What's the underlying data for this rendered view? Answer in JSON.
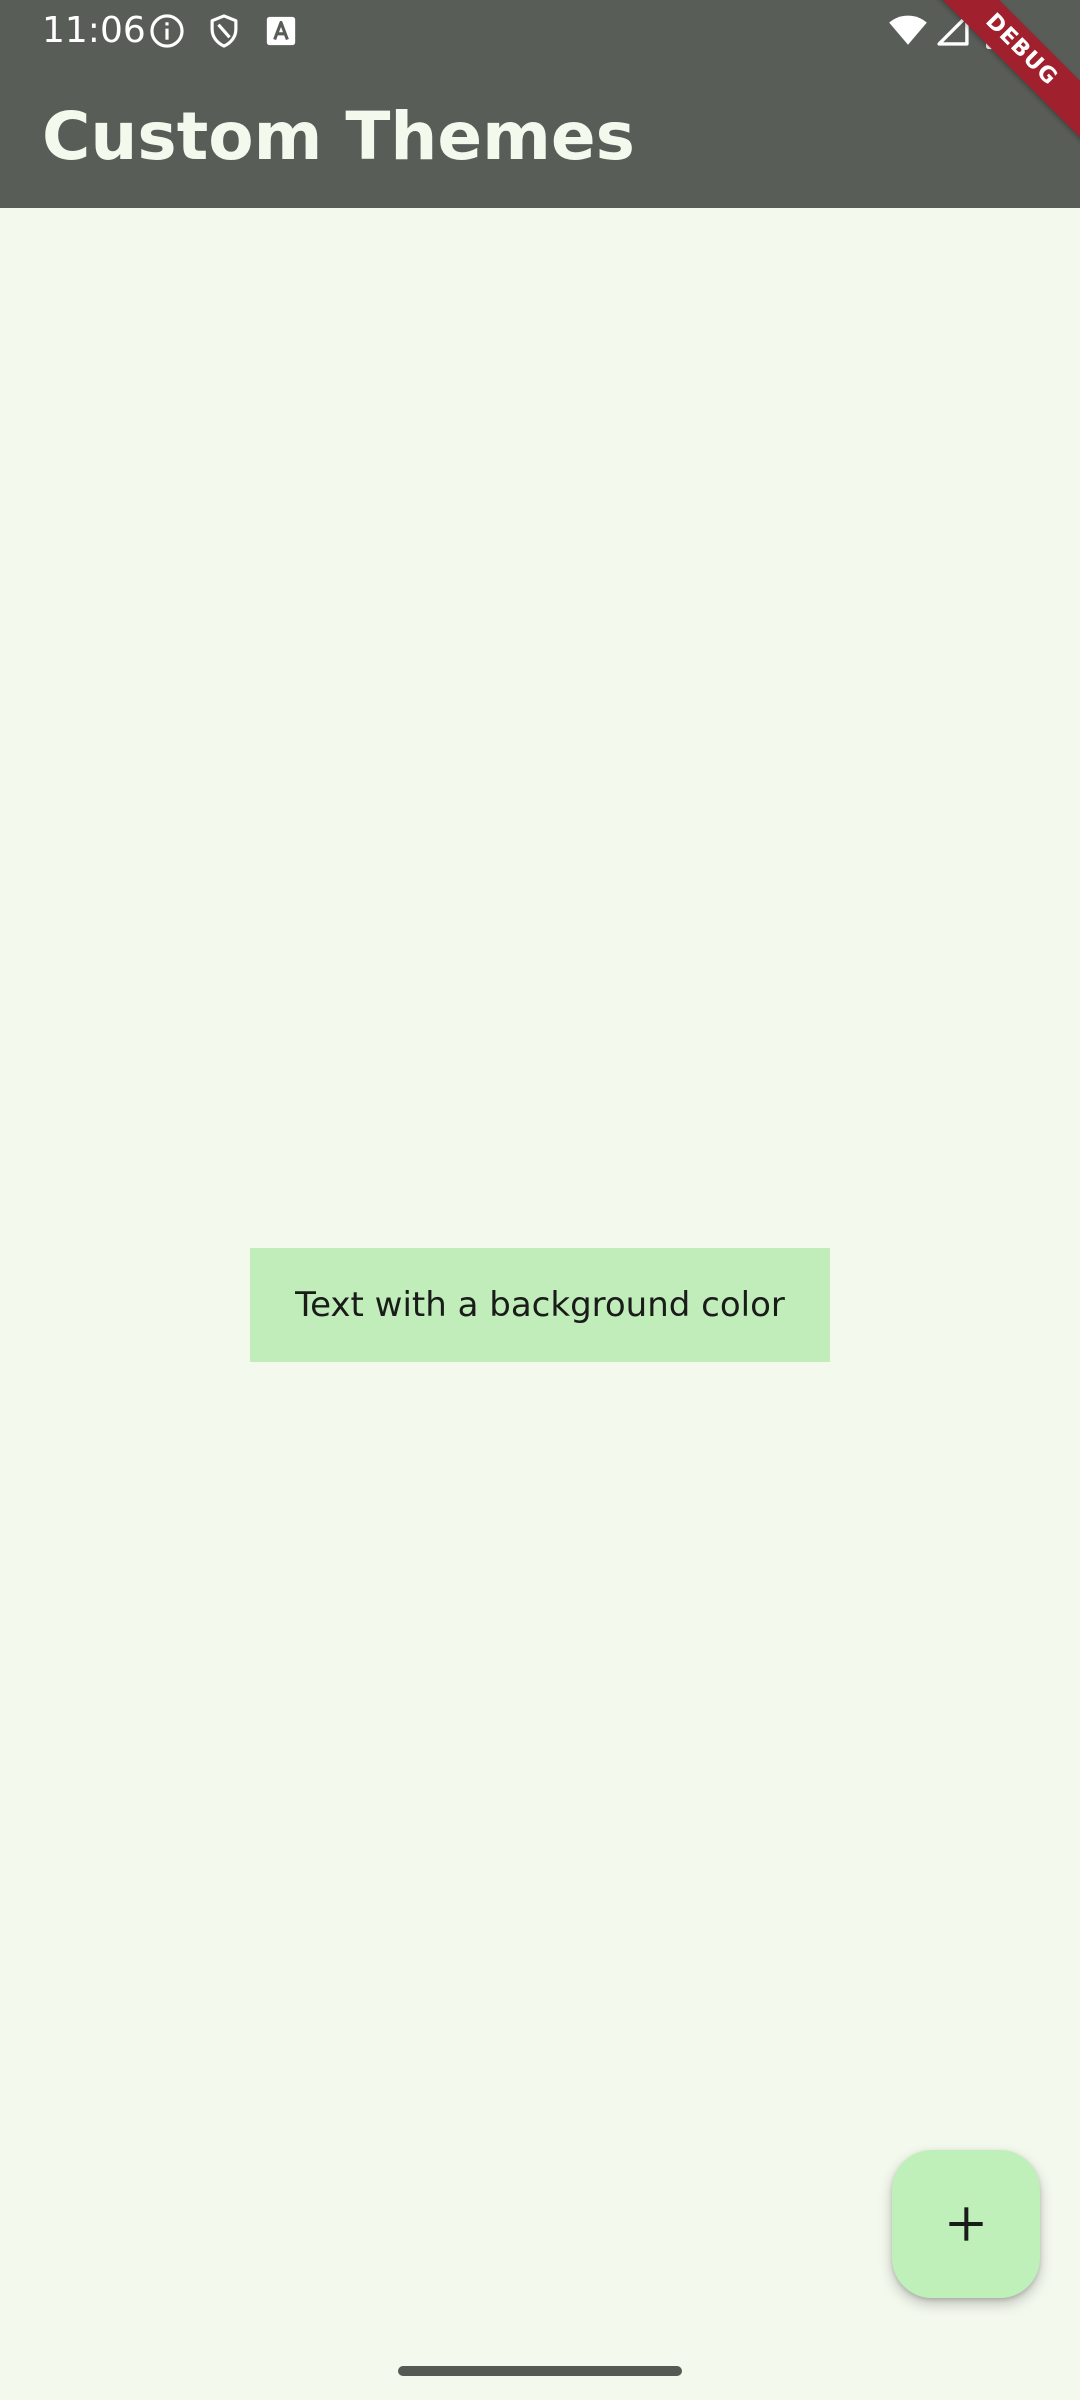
{
  "status_bar": {
    "time": "11:06",
    "icons": [
      "info-icon",
      "shield-icon",
      "accessibility-a-icon",
      "wifi-icon",
      "signal-icon",
      "battery-icon"
    ]
  },
  "debug_banner": {
    "label": "DEBUG"
  },
  "app_bar": {
    "title": "Custom Themes"
  },
  "content": {
    "text": "Text with a background color"
  },
  "fab": {
    "icon": "plus-icon"
  },
  "colors": {
    "app_bar": "#585d58",
    "background": "#f4f9ee",
    "text_chip": "#c1edba",
    "fab": "#bff0b9",
    "debug_banner": "#a0202e"
  }
}
